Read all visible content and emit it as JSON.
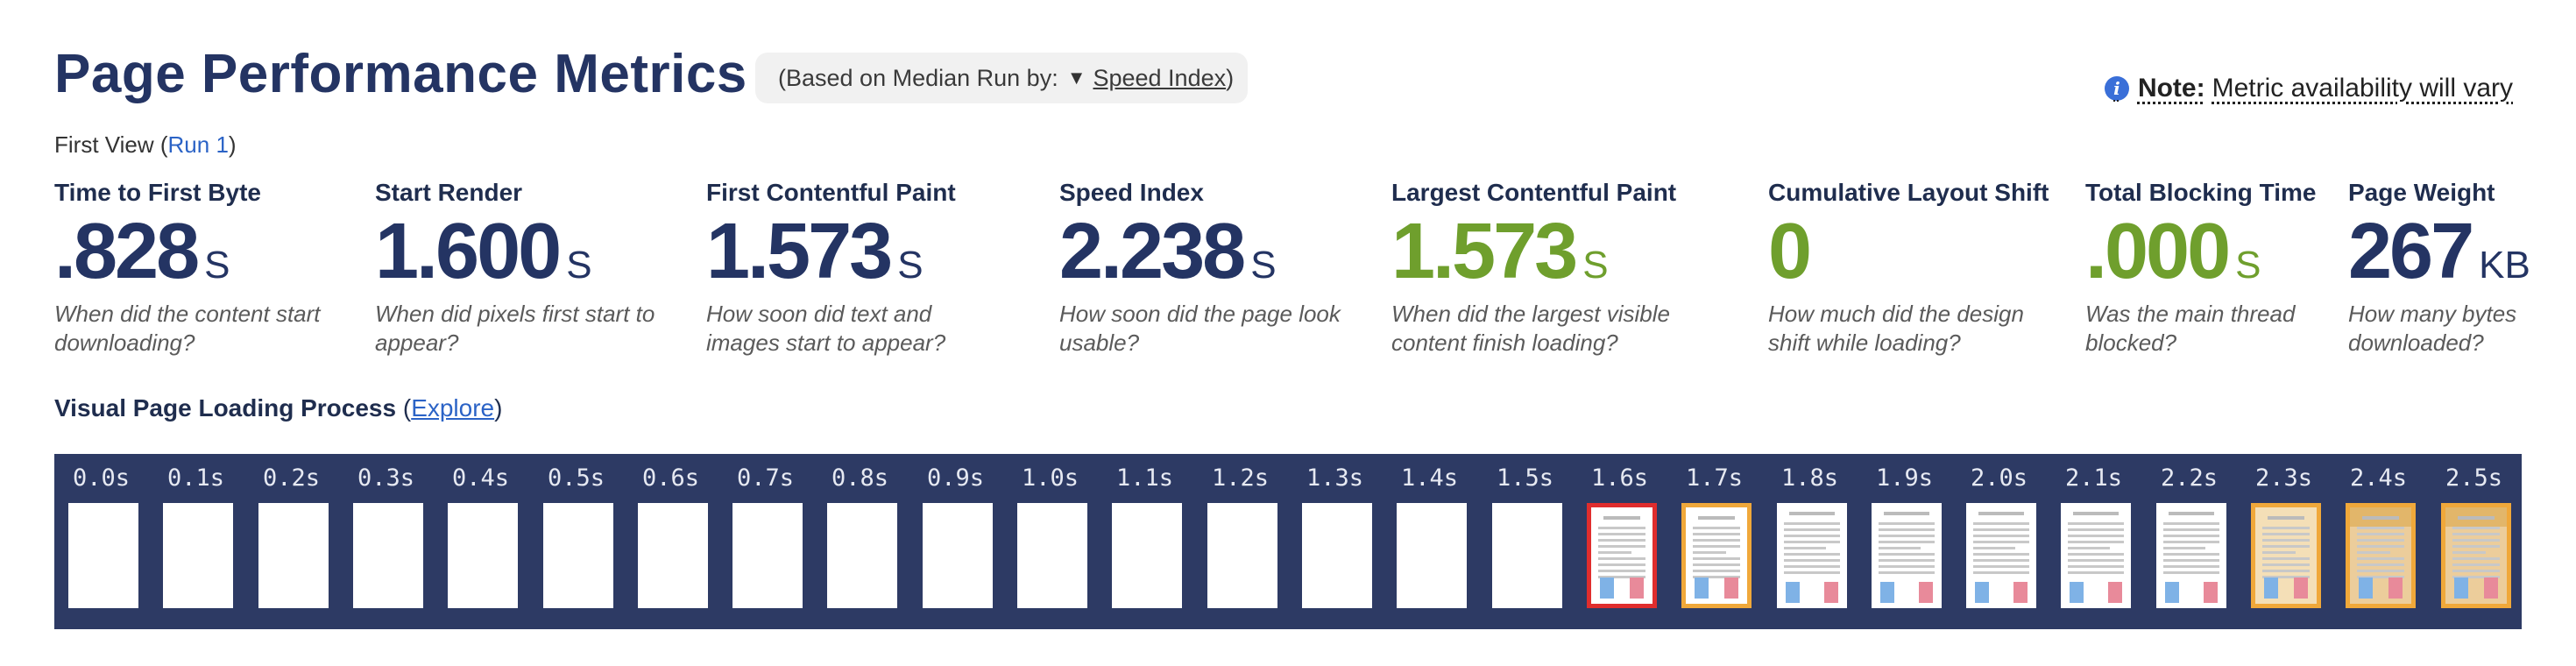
{
  "header": {
    "title": "Page Performance Metrics",
    "median_prefix": "(Based on Median Run by:",
    "median_metric": "Speed Index",
    "median_suffix": ")",
    "note_label": "Note:",
    "note_text": "Metric availability will vary",
    "first_view_label": "First View (",
    "first_view_run": "Run 1",
    "first_view_close": ")"
  },
  "metrics": [
    {
      "label": "Time to First Byte",
      "value": ".828",
      "unit": "S",
      "desc": "When did the content start downloading?",
      "color": "#243463"
    },
    {
      "label": "Start Render",
      "value": "1.600",
      "unit": "S",
      "desc": "When did pixels first start to appear?",
      "color": "#243463"
    },
    {
      "label": "First Contentful Paint",
      "value": "1.573",
      "unit": "S",
      "desc": "How soon did text and images start to appear?",
      "color": "#243463"
    },
    {
      "label": "Speed Index",
      "value": "2.238",
      "unit": "S",
      "desc": "How soon did the page look usable?",
      "color": "#243463"
    },
    {
      "label": "Largest Contentful Paint",
      "value": "1.573",
      "unit": "S",
      "desc": "When did the largest visible content finish loading?",
      "color": "#6f9f2d"
    },
    {
      "label": "Cumulative Layout Shift",
      "value": "0",
      "unit": "",
      "desc": "How much did the design shift while loading?",
      "color": "#6f9f2d"
    },
    {
      "label": "Total Blocking Time",
      "value": ".000",
      "unit": "S",
      "desc": "Was the main thread blocked?",
      "color": "#6f9f2d"
    },
    {
      "label": "Page Weight",
      "value": "267",
      "unit": "KB",
      "desc": "How many bytes downloaded?",
      "color": "#243463"
    }
  ],
  "visual": {
    "heading": "Visual Page Loading Process",
    "explore_label": "Explore",
    "paren_open": "(",
    "paren_close": ")",
    "frames": [
      {
        "time": "0.0s",
        "state": "blank"
      },
      {
        "time": "0.1s",
        "state": "blank"
      },
      {
        "time": "0.2s",
        "state": "blank"
      },
      {
        "time": "0.3s",
        "state": "blank"
      },
      {
        "time": "0.4s",
        "state": "blank"
      },
      {
        "time": "0.5s",
        "state": "blank"
      },
      {
        "time": "0.6s",
        "state": "blank"
      },
      {
        "time": "0.7s",
        "state": "blank"
      },
      {
        "time": "0.8s",
        "state": "blank"
      },
      {
        "time": "0.9s",
        "state": "blank"
      },
      {
        "time": "1.0s",
        "state": "blank"
      },
      {
        "time": "1.1s",
        "state": "blank"
      },
      {
        "time": "1.2s",
        "state": "blank"
      },
      {
        "time": "1.3s",
        "state": "blank"
      },
      {
        "time": "1.4s",
        "state": "blank"
      },
      {
        "time": "1.5s",
        "state": "blank"
      },
      {
        "time": "1.6s",
        "state": "first-paint"
      },
      {
        "time": "1.7s",
        "state": "changed"
      },
      {
        "time": "1.8s",
        "state": "text"
      },
      {
        "time": "1.9s",
        "state": "text"
      },
      {
        "time": "2.0s",
        "state": "text"
      },
      {
        "time": "2.1s",
        "state": "text"
      },
      {
        "time": "2.2s",
        "state": "text"
      },
      {
        "time": "2.3s",
        "state": "changed-warm"
      },
      {
        "time": "2.4s",
        "state": "changed-warm2"
      },
      {
        "time": "2.5s",
        "state": "changed-warm2"
      }
    ]
  },
  "colors": {
    "title": "#243463",
    "good": "#6f9f2d",
    "filmstrip_bg": "#2d3a64",
    "frame_changed_border": "#f0a83a",
    "frame_first_border": "#e02d2d",
    "link": "#2b63c6"
  }
}
